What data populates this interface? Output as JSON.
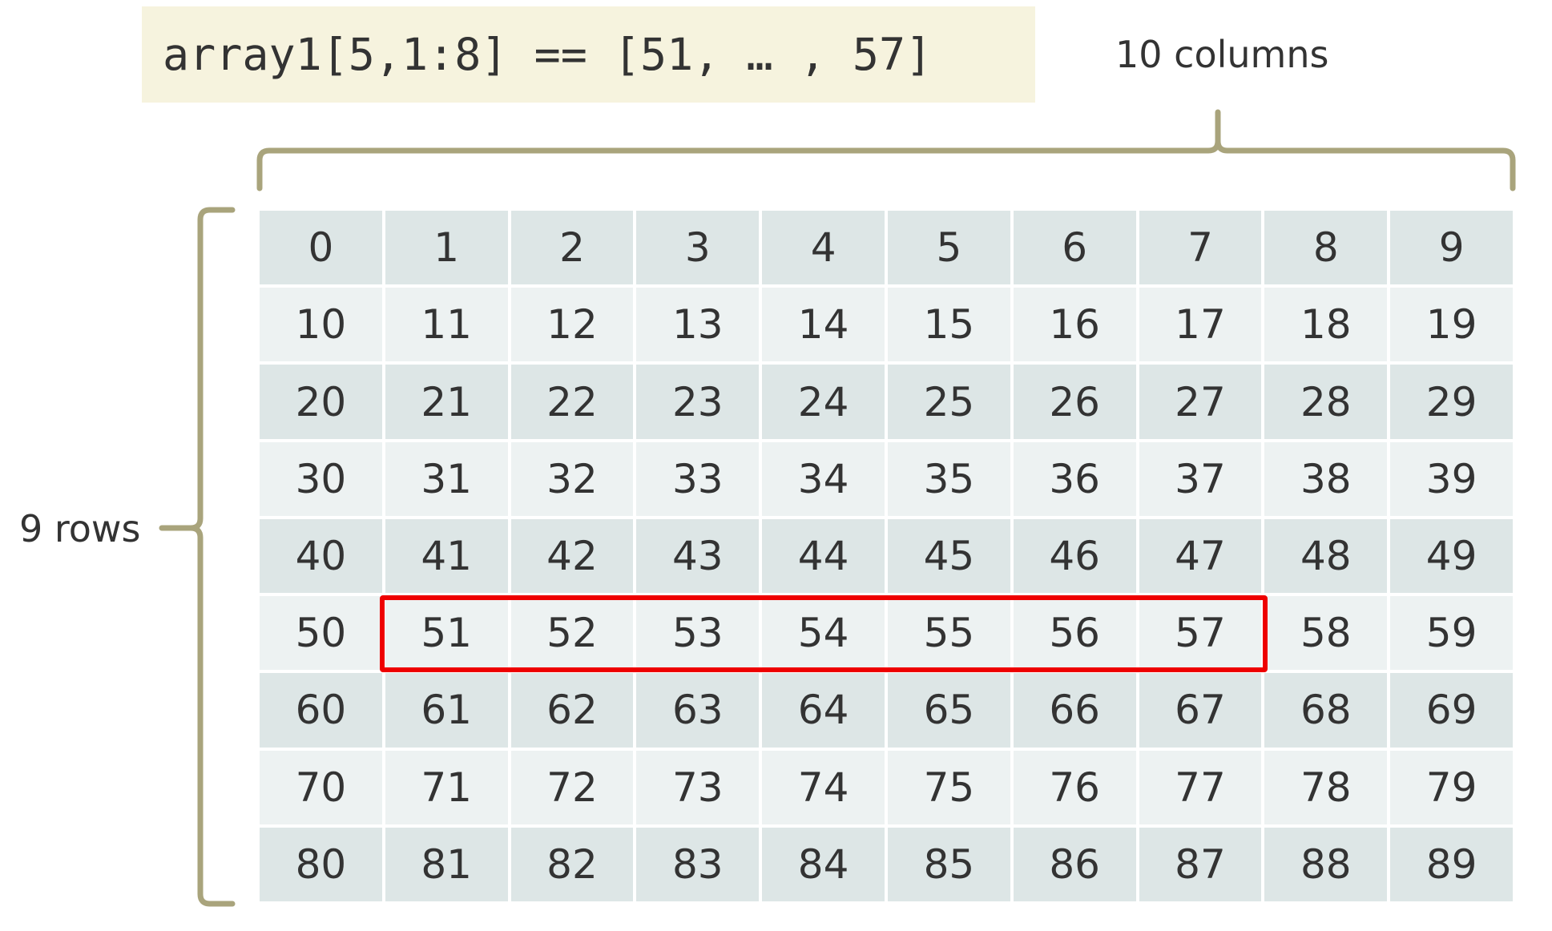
{
  "code_expression": "array1[5,1:8] == [51, … , 57]",
  "columns_label": "10 columns",
  "rows_label": "9 rows",
  "colors": {
    "code_background": "#f6f3de",
    "brace": "#a9a47c",
    "cell_dark": "#dde6e6",
    "cell_light": "#edf2f2",
    "highlight": "#ee0000"
  },
  "grid": {
    "rows": [
      [
        "0",
        "1",
        "2",
        "3",
        "4",
        "5",
        "6",
        "7",
        "8",
        "9"
      ],
      [
        "10",
        "11",
        "12",
        "13",
        "14",
        "15",
        "16",
        "17",
        "18",
        "19"
      ],
      [
        "20",
        "21",
        "22",
        "23",
        "24",
        "25",
        "26",
        "27",
        "28",
        "29"
      ],
      [
        "30",
        "31",
        "32",
        "33",
        "34",
        "35",
        "36",
        "37",
        "38",
        "39"
      ],
      [
        "40",
        "41",
        "42",
        "43",
        "44",
        "45",
        "46",
        "47",
        "48",
        "49"
      ],
      [
        "50",
        "51",
        "52",
        "53",
        "54",
        "55",
        "56",
        "57",
        "58",
        "59"
      ],
      [
        "60",
        "61",
        "62",
        "63",
        "64",
        "65",
        "66",
        "67",
        "68",
        "69"
      ],
      [
        "70",
        "71",
        "72",
        "73",
        "74",
        "75",
        "76",
        "77",
        "78",
        "79"
      ],
      [
        "80",
        "81",
        "82",
        "83",
        "84",
        "85",
        "86",
        "87",
        "88",
        "89"
      ]
    ],
    "highlight": {
      "row": 5,
      "col_start": 1,
      "col_end": 8
    }
  }
}
